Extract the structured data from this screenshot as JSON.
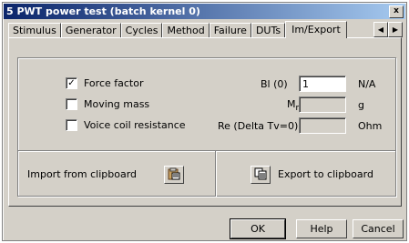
{
  "window": {
    "title": "5 PWT power test (batch kernel 0)",
    "close_glyph": "x"
  },
  "tabs": [
    {
      "label": "Stimulus"
    },
    {
      "label": "Generator"
    },
    {
      "label": "Cycles"
    },
    {
      "label": "Method"
    },
    {
      "label": "Failure"
    },
    {
      "label": "DUTs"
    },
    {
      "label": "Im/Export",
      "active": true
    }
  ],
  "options": {
    "force_factor": {
      "label": "Force factor",
      "checked": true
    },
    "moving_mass": {
      "label": "Moving mass",
      "checked": false
    },
    "voice_coil_resistance": {
      "label": "Voice coil resistance",
      "checked": false
    }
  },
  "fields": {
    "bl": {
      "label": "Bl (0)",
      "value": "1",
      "unit": "N/A"
    },
    "mms": {
      "label_main": "M",
      "label_sub": "ms",
      "value": "",
      "unit": "g"
    },
    "re": {
      "label": "Re (Delta Tv=0)",
      "value": "",
      "unit": "Ohm"
    }
  },
  "import": {
    "label": "Import from clipboard",
    "icon": "paste-icon"
  },
  "export": {
    "label": "Export to clipboard",
    "icon": "copy-icon"
  },
  "buttons": {
    "ok": "OK",
    "help": "Help",
    "cancel": "Cancel"
  }
}
